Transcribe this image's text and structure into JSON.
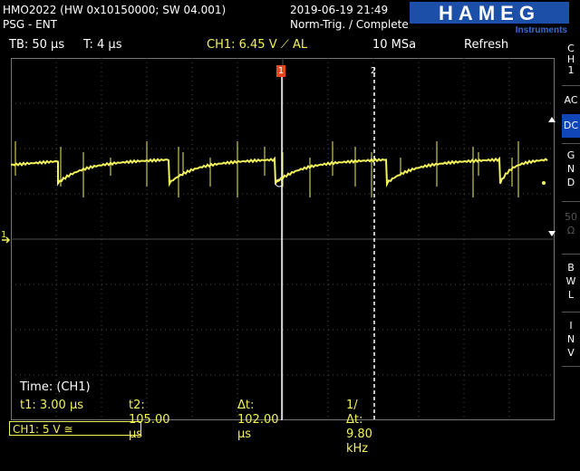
{
  "header": {
    "device_line": "HMO2022 (HW 0x10150000; SW 04.001)",
    "mode_line": "PSG - ENT",
    "datetime": "2019-06-19 21:49",
    "trigger_state": "Norm-Trig. / Complete",
    "brand": "HAMEG",
    "brand_sub": "Instruments"
  },
  "status": {
    "timebase": "TB: 50 µs",
    "trigger_time": "T: 4 µs",
    "trigger": "CH1: 6.45 V ⟋ AL",
    "sample_rate": "10 MSa",
    "acq_mode": "Refresh"
  },
  "markers": {
    "cursor1": "1",
    "cursor2": "2",
    "ground": "1"
  },
  "cursor_panel": {
    "title": "Time: (CH1)",
    "t1": "t1: 3.00 µs",
    "t2": "t2: 105.00 µs",
    "dt": "Δt: 102.00 µs",
    "inv_dt": "1/Δt: 9.80 kHz"
  },
  "sidebar": {
    "channel": [
      "C",
      "H",
      "1"
    ],
    "ac": "AC",
    "dc": "DC",
    "gnd": [
      "G",
      "N",
      "D"
    ],
    "ohm50": [
      "50",
      "Ω"
    ],
    "bwl": [
      "B",
      "W",
      "L"
    ],
    "inv": [
      "I",
      "N",
      "V"
    ]
  },
  "bottom": {
    "channel_scale": "CH1: 5 V ≅"
  },
  "colors": {
    "trace": "#f2f25a",
    "grid": "#4a4a4a",
    "active_button": "#1046b8",
    "trigger_marker": "#e8481c",
    "brand": "#1c4fa8"
  }
}
